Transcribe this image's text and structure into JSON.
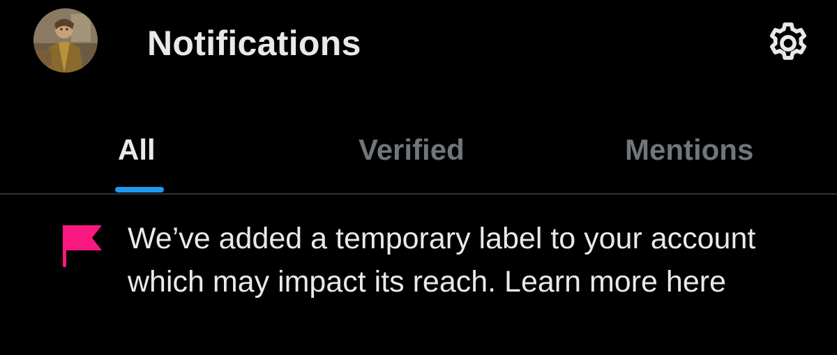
{
  "header": {
    "title": "Notifications",
    "avatar_icon": "profile-avatar",
    "settings_icon": "gear-icon"
  },
  "tabs": [
    {
      "label": "All",
      "active": true
    },
    {
      "label": "Verified",
      "active": false
    },
    {
      "label": "Mentions",
      "active": false
    }
  ],
  "notification": {
    "icon": "flag-icon",
    "text": "We’ve added a temporary label to your account which may impact its reach. Learn more here"
  },
  "colors": {
    "background": "#000000",
    "primary_text": "#e7e9ea",
    "secondary_text": "#71767b",
    "accent": "#1d9bf0",
    "flag": "#f91880",
    "divider": "#2f3336"
  }
}
